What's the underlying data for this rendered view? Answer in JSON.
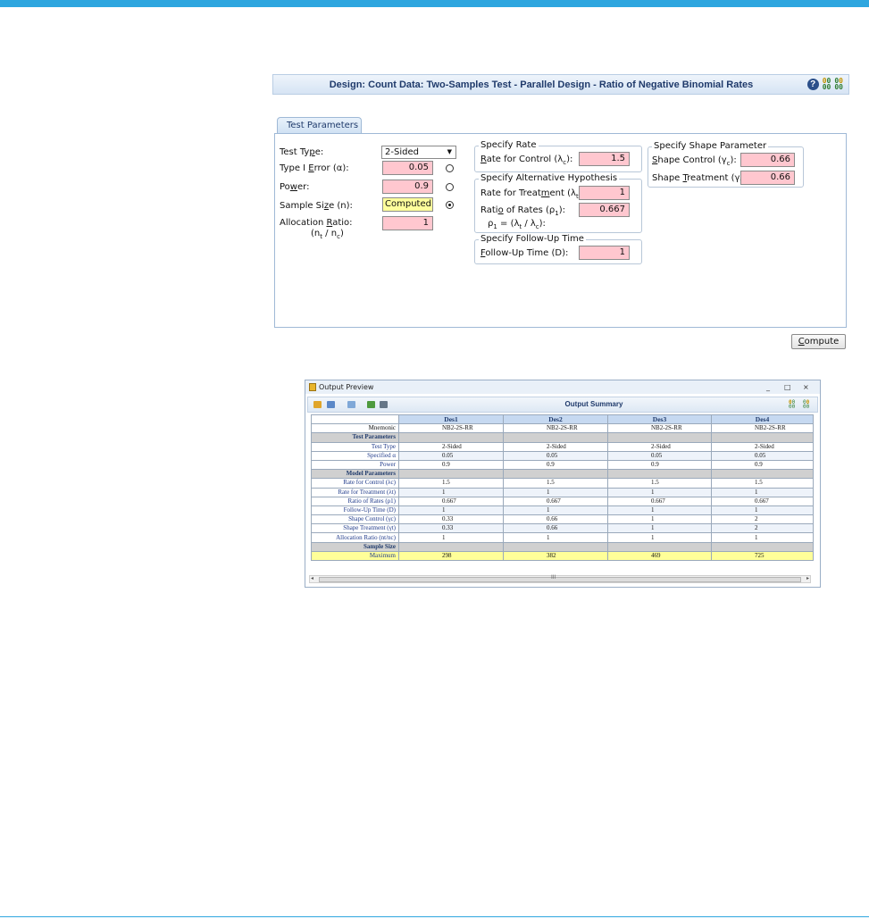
{
  "design_bar": {
    "title": "Design: Count Data: Two-Samples Test - Parallel Design - Ratio of Negative Binomial Rates",
    "help_icon": "help-icon",
    "icons": [
      "input-output-icon",
      "input-output-icon"
    ]
  },
  "tab": {
    "label": "Test Parameters"
  },
  "params": {
    "test_type_label_pre": "Test Ty",
    "test_type_label_u": "p",
    "test_type_label_post": "e:",
    "test_type_value": "2-Sided",
    "alpha_label_pre": "Type I ",
    "alpha_label_u": "E",
    "alpha_label_post": "rror (α):",
    "alpha_value": "0.05",
    "power_label_pre": "Po",
    "power_label_u": "w",
    "power_label_post": "er:",
    "power_value": "0.9",
    "n_label_pre": "Sample Si",
    "n_label_u": "z",
    "n_label_post": "e (n):",
    "n_value": "Computed",
    "alloc_label_pre": "Allocation ",
    "alloc_label_u": "R",
    "alloc_label_post": "atio:",
    "alloc_sub": "(n",
    "alloc_sub_t": "t",
    "alloc_sub_mid": " / n",
    "alloc_sub_c": "c",
    "alloc_sub_end": ")",
    "alloc_value": "1"
  },
  "rate_group": {
    "title": "Specify Rate",
    "control_label_u": "R",
    "control_label_post": "ate for Control (λ",
    "control_sub": "c",
    "control_end": "):",
    "control_value": "1.5"
  },
  "alt_group": {
    "title": "Specify Alternative Hypothesis",
    "treat_label_pre": "Rate for Treat",
    "treat_label_u": "m",
    "treat_label_post": "ent (λ",
    "treat_sub": "t",
    "treat_end": "):",
    "treat_value": "1",
    "ratio_label_pre": "Rati",
    "ratio_label_u": "o",
    "ratio_label_post": " of Rates (ρ",
    "ratio_sub": "1",
    "ratio_end": "):",
    "ratio_value": "0.667",
    "ratio_formula_pre": "ρ",
    "ratio_formula_sub1": "1",
    "ratio_formula_mid": " = (λ",
    "ratio_formula_sub2": "t",
    "ratio_formula_mid2": " / λ",
    "ratio_formula_sub3": "c",
    "ratio_formula_end": "):"
  },
  "followup_group": {
    "title": "Specify Follow-Up Time",
    "label_u": "F",
    "label_post": "ollow-Up Time (D):",
    "value": "1"
  },
  "shape_group": {
    "title": "Specify Shape Parameter",
    "control_label_u": "S",
    "control_label_post": "hape Control (γ",
    "control_sub": "c",
    "control_end": "):",
    "control_value": "0.66",
    "treat_label_pre": "Shape ",
    "treat_label_u": "T",
    "treat_label_post": "reatment (γ",
    "treat_sub": "t",
    "treat_end": "):",
    "treat_value": "0.66"
  },
  "compute_button": {
    "label_u": "C",
    "label_post": "ompute"
  },
  "output_window": {
    "title": "Output Preview",
    "minimize": "_",
    "maximize": "□",
    "close": "×",
    "summary_title": "Output Summary",
    "scroll_grip": "III",
    "scroll_left": "◂",
    "scroll_right": "▸"
  },
  "summary_table": {
    "columns": [
      "Des1",
      "Des2",
      "Des3",
      "Des4"
    ],
    "rows": [
      {
        "label": "Mnemonic",
        "values": [
          "NB2-2S-RR",
          "NB2-2S-RR",
          "NB2-2S-RR",
          "NB2-2S-RR"
        ],
        "kind": "plain"
      },
      {
        "label": "Test Parameters",
        "values": [
          "",
          "",
          "",
          ""
        ],
        "kind": "section"
      },
      {
        "label": "Test Type",
        "values": [
          "2-Sided",
          "2-Sided",
          "2-Sided",
          "2-Sided"
        ],
        "kind": "data"
      },
      {
        "label": "Specified α",
        "values": [
          "0.05",
          "0.05",
          "0.05",
          "0.05"
        ],
        "kind": "data"
      },
      {
        "label": "Power",
        "values": [
          "0.9",
          "0.9",
          "0.9",
          "0.9"
        ],
        "kind": "data"
      },
      {
        "label": "Model Parameters",
        "values": [
          "",
          "",
          "",
          ""
        ],
        "kind": "section"
      },
      {
        "label": "Rate for Control (λc)",
        "values": [
          "1.5",
          "1.5",
          "1.5",
          "1.5"
        ],
        "kind": "data"
      },
      {
        "label": "Rate for Treatment (λt)",
        "values": [
          "1",
          "1",
          "1",
          "1"
        ],
        "kind": "data"
      },
      {
        "label": "Ratio of Rates (ρ1)",
        "values": [
          "0.667",
          "0.667",
          "0.667",
          "0.667"
        ],
        "kind": "data"
      },
      {
        "label": "Follow-Up Time (D)",
        "values": [
          "1",
          "1",
          "1",
          "1"
        ],
        "kind": "data"
      },
      {
        "label": "Shape Control (γc)",
        "values": [
          "0.33",
          "0.66",
          "1",
          "2"
        ],
        "kind": "data"
      },
      {
        "label": "Shape Treatment (γt)",
        "values": [
          "0.33",
          "0.66",
          "1",
          "2"
        ],
        "kind": "data"
      },
      {
        "label": "Allocation Ratio (nt/nc)",
        "values": [
          "1",
          "1",
          "1",
          "1"
        ],
        "kind": "data"
      },
      {
        "label": "Sample Size",
        "values": [
          "",
          "",
          "",
          ""
        ],
        "kind": "section"
      },
      {
        "label": "Maximum",
        "values": [
          "298",
          "382",
          "469",
          "725"
        ],
        "kind": "highlight"
      }
    ]
  },
  "colors": {
    "accent_stripe": "#2ea6df",
    "input_pink": "#ffc7cf",
    "computed_yellow": "#ffff9c",
    "header_blue": "#c6d9f1"
  }
}
